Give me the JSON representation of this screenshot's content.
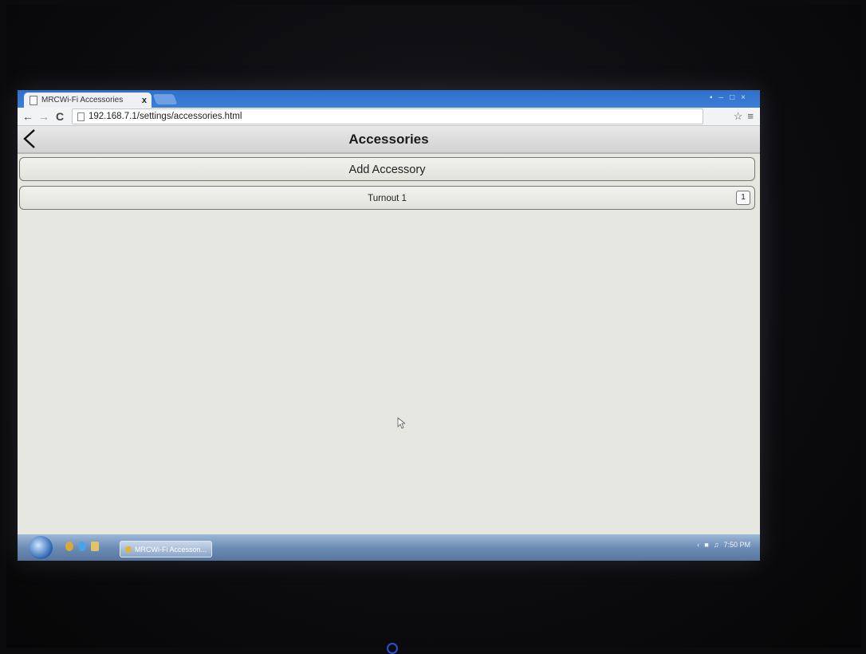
{
  "browser": {
    "tab_title": "MRCWi-Fi Accessories",
    "tab_close": "x",
    "address": "192.168.7.1/settings/accessories.html"
  },
  "app": {
    "title": "Accessories",
    "add_button_label": "Add Accessory",
    "accessories": [
      {
        "name": "Turnout 1",
        "number": "1"
      }
    ]
  },
  "taskbar": {
    "task_label": "MRCWi-Fi Accesson...",
    "clock": "7:50 PM"
  },
  "colors": {
    "tabstrip": "#3b7fd6",
    "page_background": "#e6e7e1",
    "taskbar": "#6d8db5"
  }
}
